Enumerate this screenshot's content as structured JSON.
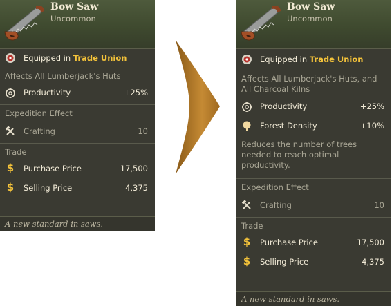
{
  "item": {
    "name": "Bow Saw",
    "rarity": "Uncommon",
    "equipped_prefix": "Equipped in ",
    "equipped_location": "Trade Union",
    "productivity_label": "Productivity",
    "productivity_value": "+25%",
    "expedition_title": "Expedition Effect",
    "crafting_label": "Crafting",
    "crafting_value": "10",
    "trade_title": "Trade",
    "purchase_label": "Purchase Price",
    "purchase_value": "17,500",
    "selling_label": "Selling Price",
    "selling_value": "4,375",
    "flavor": "A new standard in saws."
  },
  "before": {
    "affects": "Affects All Lumberjack's Huts"
  },
  "after": {
    "affects_line1": "Affects All Lumberjack's Huts, and",
    "affects_line2": "All Charcoal Kilns",
    "forest_label": "Forest Density",
    "forest_value": "+10%",
    "desc_line1": "Reduces the number of trees",
    "desc_line2": "needed to reach optimal",
    "desc_line3": "productivity."
  },
  "colors": {
    "highlight": "#f3c23a",
    "panel": "#3a3a32",
    "arrow": "#c0862d"
  },
  "icons": [
    "saw-icon",
    "equipped-icon",
    "productivity-icon",
    "forest-density-icon",
    "crafting-icon",
    "dollar-icon"
  ]
}
